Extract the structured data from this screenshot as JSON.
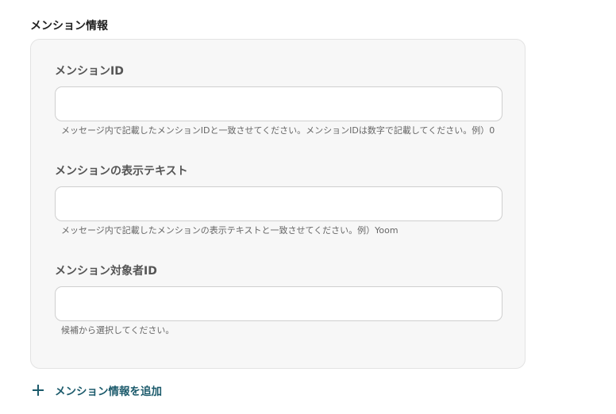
{
  "section": {
    "title": "メンション情報"
  },
  "fields": [
    {
      "label": "メンションID",
      "value": "",
      "placeholder": "",
      "help": "メッセージ内で記載したメンションIDと一致させてください。メンションIDは数字で記載してください。例）0"
    },
    {
      "label": "メンションの表示テキスト",
      "value": "",
      "placeholder": "",
      "help": "メッセージ内で記載したメンションの表示テキストと一致させてください。例）Yoom"
    },
    {
      "label": "メンション対象者ID",
      "value": "",
      "placeholder": "",
      "help": "候補から選択してください。"
    }
  ],
  "add_button": {
    "label": "メンション情報を追加",
    "icon": "plus-icon"
  },
  "colors": {
    "accent": "#1b5a6b",
    "card_bg": "#f7f7f7",
    "input_border": "#cfcfcf"
  }
}
